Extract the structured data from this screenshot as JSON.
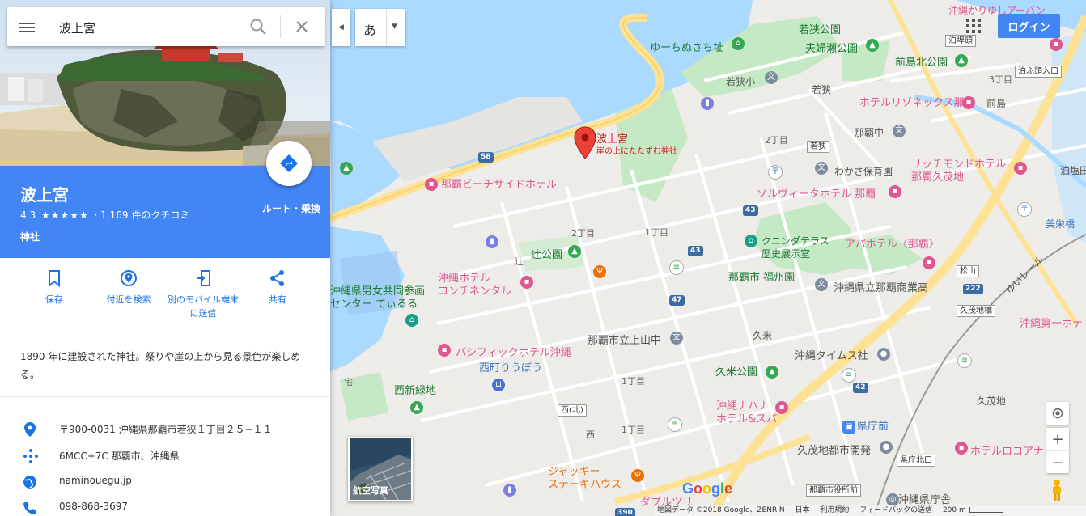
{
  "search": {
    "value": "波上宮"
  },
  "place": {
    "title": "波上宮",
    "rating": "4.3",
    "stars": "★★★★★",
    "reviews": "· 1,169 件のクチコミ",
    "category": "神社",
    "route_label": "ルート・乗換",
    "description": "1890 年に建設された神社。祭りや崖の上から見る景色が楽しめる。"
  },
  "actions": [
    {
      "label": "保存"
    },
    {
      "label": "付近を検索"
    },
    {
      "label": "別のモバイル端末に送信"
    },
    {
      "label": "共有"
    }
  ],
  "info": {
    "address": "〒900-0031 沖縄県那覇市若狭１丁目２５−１１",
    "plus_code": "6MCC+7C 那覇市、沖縄県",
    "website": "naminouegu.jp",
    "phone": "098-868-3697"
  },
  "controls": {
    "ime_char": "あ",
    "login": "ログイン",
    "satellite": "航空写真",
    "zoom_in": "+",
    "zoom_out": "−"
  },
  "google_logo": "Google",
  "footer": {
    "data": "地図データ ©2018 Google、ZENRIN",
    "country": "日本",
    "terms": "利用規約",
    "feedback": "フィードバックの送信",
    "scale": "200 m"
  },
  "map": {
    "pin_title": "波上宮",
    "pin_subtitle": "崖の上にたたずむ神社",
    "labels": {
      "wakasa_park": "若狭公園",
      "meoto_park": "夫婦瀬公園",
      "maejima_park": "前島北公園",
      "okinawa_kariyushi": "沖縄かりゆしアーバン",
      "tomarinobashi": "泊埠頭",
      "tomari_entrance": "泊ふ頭入口",
      "yuuchi": "ゆーちぬさち址",
      "wakasa_elem": "若狭小",
      "wakasa": "若狭",
      "maejima_3": "3丁目",
      "maejima": "前島",
      "hotel_resonex": "ホテルリゾネックス那覇",
      "naha_jr_high": "那覇中",
      "nichome_a": "2丁目",
      "wakasa_box": "若狭",
      "wakasa_nursery": "わかさ保育園",
      "richmond": "リッチモンドホテル\n那覇久茂地",
      "tomari": "泊塩田",
      "beach_side": "那覇ビーチサイドホテル",
      "solvita": "ソルヴィータホテル 那覇",
      "naha_bijutsu": "美栄橋",
      "kukudeness": "クニンダテラス\n歴史展示室",
      "apa": "アパホテル〈那覇〉",
      "tsuji_park": "辻公園",
      "nichome_b": "2丁目",
      "itchome_a": "1丁目",
      "tsuji": "辻",
      "naha_fukushu": "那覇市 福州園",
      "shogyo": "沖縄県立那覇商業高",
      "matsuyama": "松山",
      "yui_rail": "ゆいレール",
      "danjo": "沖縄県男女共同参画\nセンター てぃるる",
      "okinawa_hotel": "沖縄ホテル\nコンチネンタル",
      "kumoji_box": "久茂地橋",
      "ueyama": "那覇市立上山中",
      "kume": "久米",
      "okinawa_daiichi": "沖縄第一ホテ",
      "pacific": "パシフィックホテル沖縄",
      "nishimachi": "西町りうぼう",
      "okinawa_times": "沖縄タイムス社",
      "kume_park": "久米公園",
      "nishi_ryokuchi": "西新緑地",
      "nishi_box": "西(北)",
      "kumoji": "久茂地",
      "nanahana": "沖縄ナハナ\nホテル&スパ",
      "prefecture_office": "県庁前",
      "itchome_b": "1丁目",
      "nishi": "西",
      "kumoji_toshi": "久茂地都市開発",
      "hotel_rocore": "ホテルロコアナ",
      "kencho_box": "県庁北口",
      "jackie": "ジャッキー\nステーキハウス",
      "naha_city_box": "那覇市役所前",
      "okinawa_kencho": "沖縄県庁舎",
      "daiwa": "ダブルツリ",
      "itchome_c": "1丁目",
      "sanchome": "宅"
    },
    "route_shields": [
      "58",
      "43",
      "43",
      "47",
      "42",
      "222",
      "390"
    ]
  },
  "colors": {
    "accent": "#4285f4",
    "water": "#aadaff",
    "park": "#c5e8c5",
    "highway": "#fde293",
    "pin": "#ea4335"
  }
}
